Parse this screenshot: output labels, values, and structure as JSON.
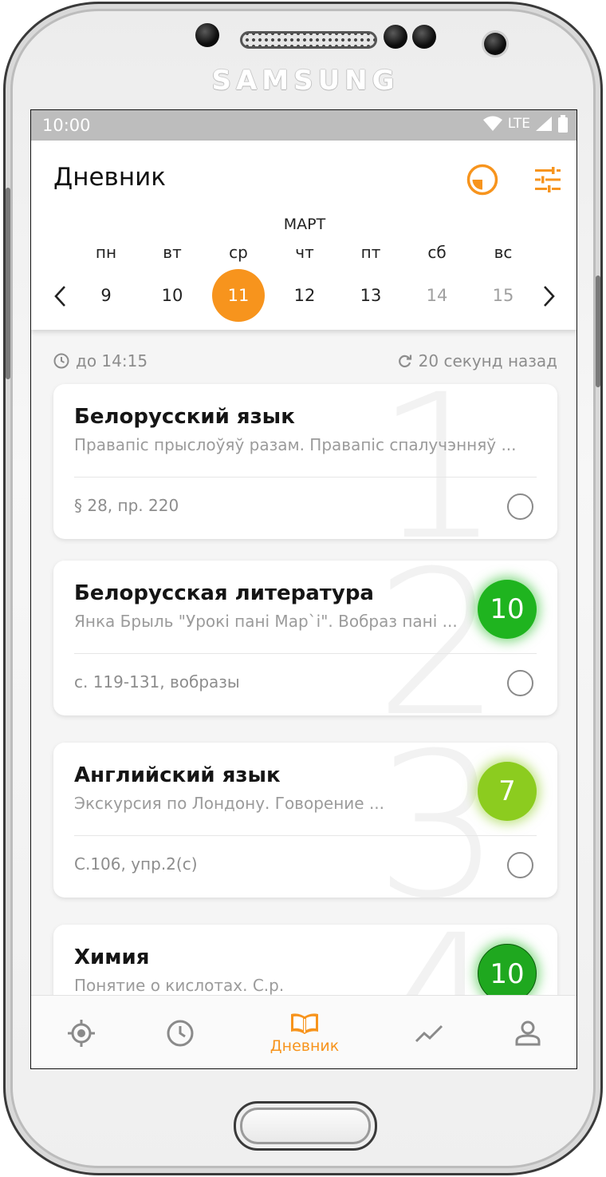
{
  "device": {
    "brand": "SAMSUNG"
  },
  "status_bar": {
    "time": "10:00",
    "network": "LTE"
  },
  "header": {
    "title": "Дневник"
  },
  "calendar": {
    "month": "МАРТ",
    "weekdays": [
      "пн",
      "вт",
      "ср",
      "чт",
      "пт",
      "сб",
      "вс"
    ],
    "days": [
      "9",
      "10",
      "11",
      "12",
      "13",
      "14",
      "15"
    ],
    "selected_index": 2,
    "inactive_indices": [
      5,
      6
    ]
  },
  "info": {
    "until": "до 14:15",
    "updated": "20 секунд назад"
  },
  "lessons": [
    {
      "number": "1",
      "subject": "Белорусский язык",
      "topic": "Правапіс прыслоўяў разам. Правапіс спалучэнняў ...",
      "homework": "§ 28, пр. 220",
      "grade": ""
    },
    {
      "number": "2",
      "subject": "Белорусская литература",
      "topic": "Янка Брыль \"Урокі пані Мар`і\". Вобраз пані ...",
      "homework": "с. 119-131, вобразы",
      "grade": "10"
    },
    {
      "number": "3",
      "subject": "Английский язык",
      "topic": "Экскурсия по Лондону. Говорение ...",
      "homework": "С.106, упр.2(с)",
      "grade": "7"
    },
    {
      "number": "4",
      "subject": "Химия",
      "topic": "Понятие о кислотах. С.р.",
      "homework": "",
      "grade": "10"
    }
  ],
  "bottom_nav": {
    "active_label": "Дневник"
  },
  "colors": {
    "accent": "#f7941d",
    "grade_10": "#1fb41f",
    "grade_7": "#8ccc1f",
    "grade_10_chem": "#1fa81f",
    "status_bar": "#bdbdbd"
  }
}
